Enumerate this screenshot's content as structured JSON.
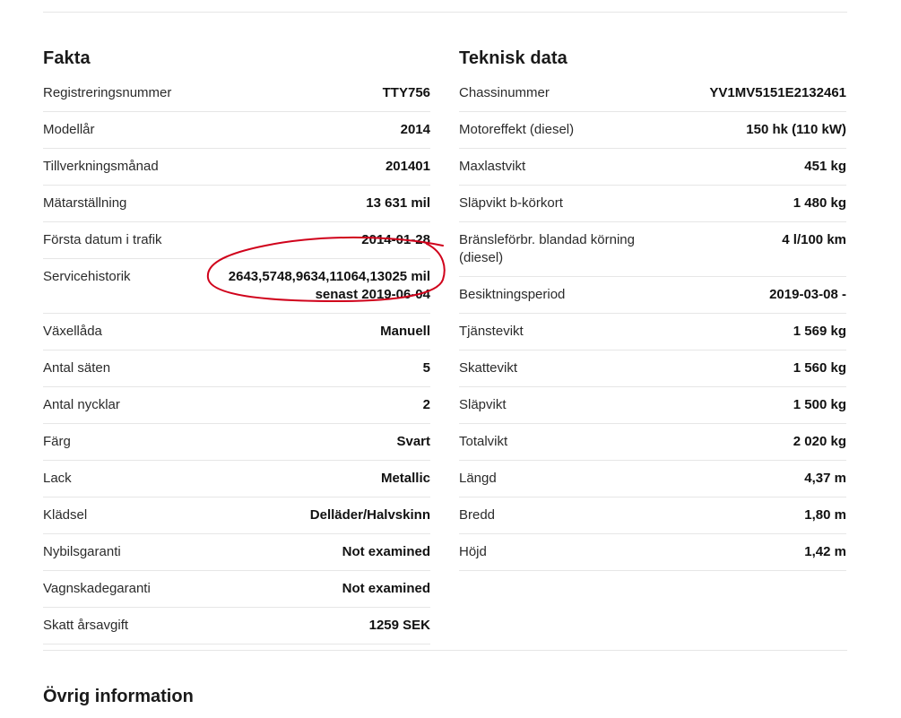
{
  "fakta": {
    "title": "Fakta",
    "rows": [
      {
        "label": "Registreringsnummer",
        "value": "TTY756"
      },
      {
        "label": "Modellår",
        "value": "2014"
      },
      {
        "label": "Tillverkningsmånad",
        "value": "201401"
      },
      {
        "label": "Mätarställning",
        "value": "13 631 mil"
      },
      {
        "label": "Första datum i trafik",
        "value": "2014-01-28"
      },
      {
        "label": "Servicehistorik",
        "value": "2643,5748,9634,11064,13025 mil senast 2019-06-04"
      },
      {
        "label": "Växellåda",
        "value": "Manuell"
      },
      {
        "label": "Antal säten",
        "value": "5"
      },
      {
        "label": "Antal nycklar",
        "value": "2"
      },
      {
        "label": "Färg",
        "value": "Svart"
      },
      {
        "label": "Lack",
        "value": "Metallic"
      },
      {
        "label": "Klädsel",
        "value": "Delläder/Halvskinn"
      },
      {
        "label": "Nybilsgaranti",
        "value": "Not examined"
      },
      {
        "label": "Vagnskadegaranti",
        "value": "Not examined"
      },
      {
        "label": "Skatt årsavgift",
        "value": "1259 SEK"
      }
    ]
  },
  "teknisk": {
    "title": "Teknisk data",
    "rows": [
      {
        "label": "Chassinummer",
        "value": "YV1MV5151E2132461"
      },
      {
        "label": "Motoreffekt (diesel)",
        "value": "150 hk (110 kW)"
      },
      {
        "label": "Maxlastvikt",
        "value": "451 kg"
      },
      {
        "label": "Släpvikt b-körkort",
        "value": "1 480 kg"
      },
      {
        "label": "Bränsleförbr. blandad körning (diesel)",
        "value": "4 l/100 km"
      },
      {
        "label": "Besiktningsperiod",
        "value": "2019-03-08 -"
      },
      {
        "label": "Tjänstevikt",
        "value": "1 569 kg"
      },
      {
        "label": "Skattevikt",
        "value": "1 560 kg"
      },
      {
        "label": "Släpvikt",
        "value": "1 500 kg"
      },
      {
        "label": "Totalvikt",
        "value": "2 020 kg"
      },
      {
        "label": "Längd",
        "value": "4,37 m"
      },
      {
        "label": "Bredd",
        "value": "1,80 m"
      },
      {
        "label": "Höjd",
        "value": "1,42 m"
      }
    ]
  },
  "other": {
    "title": "Övrig information"
  },
  "annotation_color": "#d0021b"
}
